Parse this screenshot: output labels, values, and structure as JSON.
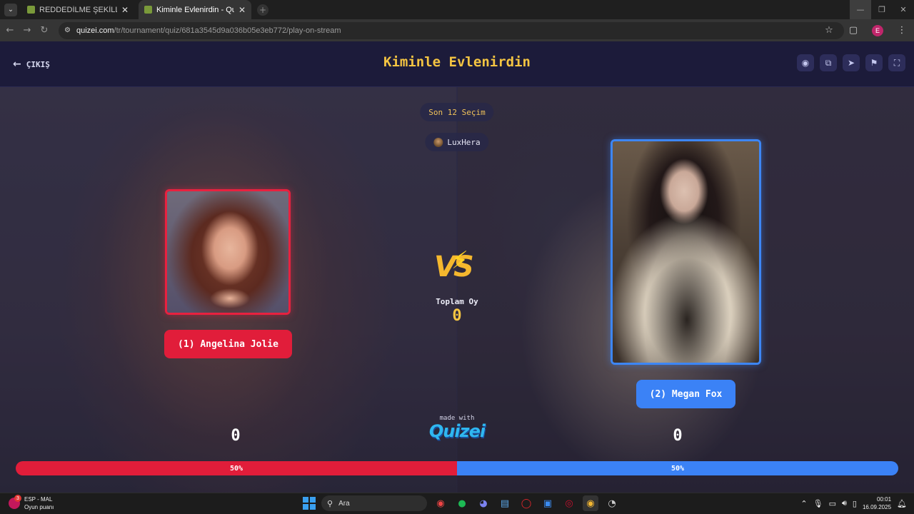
{
  "browser": {
    "tabs": [
      {
        "label": "REDDEDİLME ŞEKİLLERİ (KÖR SIÇ",
        "active": false
      },
      {
        "label": "Kiminle Evlenirdin - Quizei",
        "active": true
      }
    ],
    "url_domain": "quizei.com",
    "url_path": "/tr/tournament/quiz/681a3545d9a036b05e3eb772/play-on-stream",
    "profile_initial": "E"
  },
  "header": {
    "exit_label": "ÇIKIŞ",
    "title": "Kiminle Evlenirdin",
    "icons": [
      "eye-icon",
      "share-icon",
      "send-icon",
      "flag-icon",
      "fullscreen-icon"
    ]
  },
  "game": {
    "recent_label": "Son 12 Seçim",
    "user_name": "LuxHera",
    "vs_label": "VS",
    "total_votes_label": "Toplam Oy",
    "total_votes": "0",
    "left": {
      "name": "(1) Angelina Jolie",
      "score": "0",
      "percent": "50%",
      "color": "#e11d3a"
    },
    "right": {
      "name": "(2) Megan Fox",
      "score": "0",
      "percent": "50%",
      "color": "#3b82f6"
    },
    "made_with": "made with",
    "brand": "Quizei"
  },
  "taskbar": {
    "weather_line1": "ESP - MAL",
    "weather_line2": "Oyun puanı",
    "weather_badge": "3",
    "search_placeholder": "Ara",
    "time": "00:01",
    "date": "16.09.2025"
  }
}
